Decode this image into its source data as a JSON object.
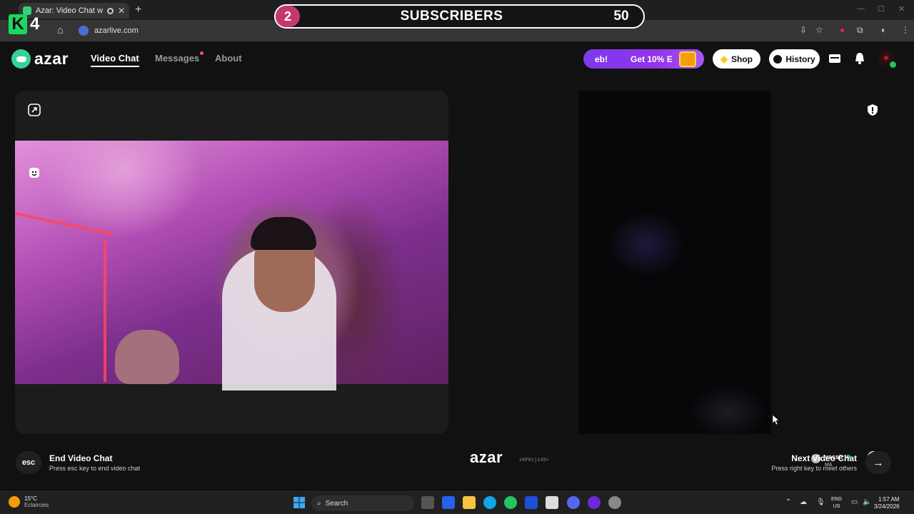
{
  "browser": {
    "tab_title": "Azar: Video Chat with New",
    "url": "azarlive.com"
  },
  "overlay": {
    "channel_badge": "4",
    "subscribers_label": "SUBSCRIBERS",
    "subscribers_count": "2",
    "subscribers_goal": "50"
  },
  "header": {
    "logo_text": "azar",
    "nav": {
      "video_chat": "Video Chat",
      "messages": "Messages",
      "about": "About"
    },
    "promo": {
      "text_left": "eb!",
      "text_right": "Get 10% E"
    },
    "shop_label": "Shop",
    "history_label": "History"
  },
  "stage": {
    "watermark": "azar",
    "session_id": "xKP8ij145+",
    "peer": {
      "name": "yassir",
      "country": "MA"
    }
  },
  "actions": {
    "esc_key": "esc",
    "end_title": "End Video Chat",
    "end_hint": "Press esc key to end video chat",
    "next_title": "Next Video Chat",
    "next_hint": "Press right key to meet others"
  },
  "taskbar": {
    "weather_temp": "15°C",
    "weather_desc": "Eclaircies",
    "search_label": "Search",
    "lang_top": "ENG",
    "lang_bottom": "US",
    "time": "1:57 AM",
    "date": "3/24/2026"
  },
  "colors": {
    "accent_green": "#34d399",
    "promo_purple": "#9333ea",
    "subs_pink": "#c4386f"
  }
}
